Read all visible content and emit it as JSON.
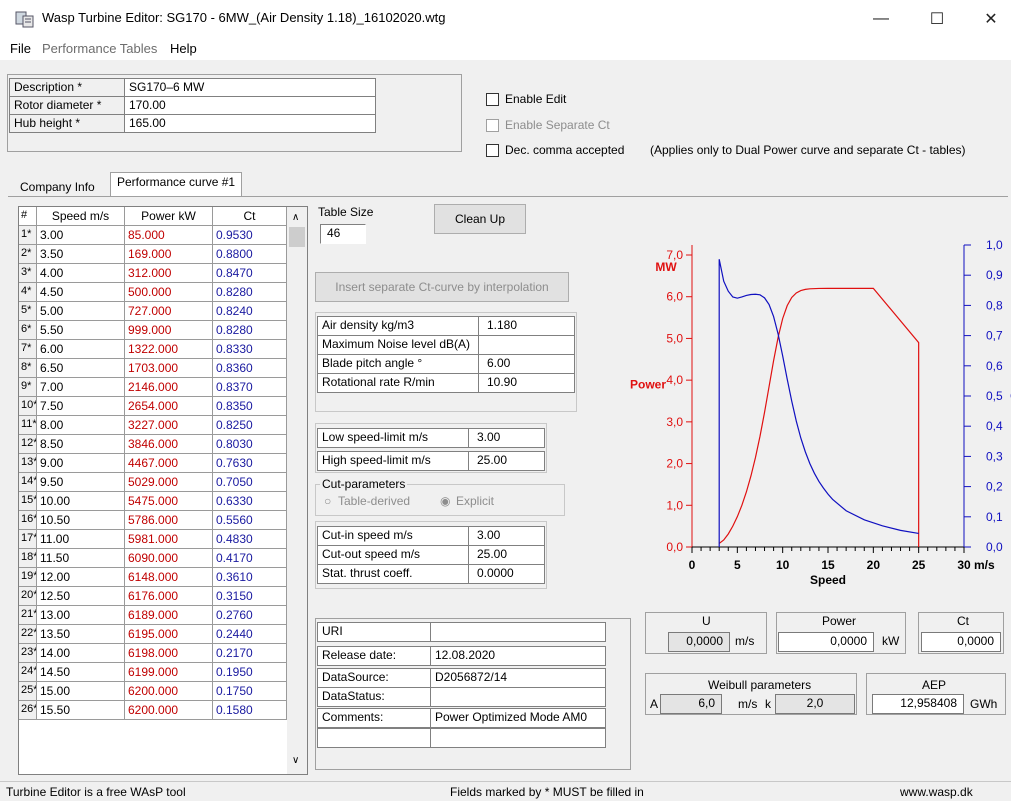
{
  "window": {
    "title": "Wasp Turbine Editor: SG170 - 6MW_(Air Density 1.18)_16102020.wtg",
    "minimize": "—",
    "maximize": "☐",
    "close": "✕"
  },
  "menu": {
    "file": "File",
    "performance_tables": "Performance Tables",
    "help": "Help"
  },
  "header_fields": {
    "description_label": "Description *",
    "description_value": "SG170–6 MW",
    "rotor_label": "Rotor diameter *",
    "rotor_value": "170.00",
    "hub_label": "Hub height *",
    "hub_value": "165.00"
  },
  "options": {
    "enable_edit": "Enable Edit",
    "enable_separate_ct": "Enable Separate Ct",
    "dec_comma": "Dec. comma accepted",
    "dec_comma_note": "(Applies only to Dual Power curve and separate Ct - tables)"
  },
  "tabs": {
    "company_info": "Company Info",
    "performance_curve": "Performance curve #1"
  },
  "grid": {
    "headers": {
      "idx": "#",
      "speed": "Speed m/s",
      "power": "Power kW",
      "ct": "Ct"
    },
    "rows": [
      [
        "1*",
        "3.00",
        "85.000",
        "0.9530"
      ],
      [
        "2*",
        "3.50",
        "169.000",
        "0.8800"
      ],
      [
        "3*",
        "4.00",
        "312.000",
        "0.8470"
      ],
      [
        "4*",
        "4.50",
        "500.000",
        "0.8280"
      ],
      [
        "5*",
        "5.00",
        "727.000",
        "0.8240"
      ],
      [
        "6*",
        "5.50",
        "999.000",
        "0.8280"
      ],
      [
        "7*",
        "6.00",
        "1322.000",
        "0.8330"
      ],
      [
        "8*",
        "6.50",
        "1703.000",
        "0.8360"
      ],
      [
        "9*",
        "7.00",
        "2146.000",
        "0.8370"
      ],
      [
        "10*",
        "7.50",
        "2654.000",
        "0.8350"
      ],
      [
        "11*",
        "8.00",
        "3227.000",
        "0.8250"
      ],
      [
        "12*",
        "8.50",
        "3846.000",
        "0.8030"
      ],
      [
        "13*",
        "9.00",
        "4467.000",
        "0.7630"
      ],
      [
        "14*",
        "9.50",
        "5029.000",
        "0.7050"
      ],
      [
        "15*",
        "10.00",
        "5475.000",
        "0.6330"
      ],
      [
        "16*",
        "10.50",
        "5786.000",
        "0.5560"
      ],
      [
        "17*",
        "11.00",
        "5981.000",
        "0.4830"
      ],
      [
        "18*",
        "11.50",
        "6090.000",
        "0.4170"
      ],
      [
        "19*",
        "12.00",
        "6148.000",
        "0.3610"
      ],
      [
        "20*",
        "12.50",
        "6176.000",
        "0.3150"
      ],
      [
        "21*",
        "13.00",
        "6189.000",
        "0.2760"
      ],
      [
        "22*",
        "13.50",
        "6195.000",
        "0.2440"
      ],
      [
        "23*",
        "14.00",
        "6198.000",
        "0.2170"
      ],
      [
        "24*",
        "14.50",
        "6199.000",
        "0.1950"
      ],
      [
        "25*",
        "15.00",
        "6200.000",
        "0.1750"
      ],
      [
        "26*",
        "15.50",
        "6200.000",
        "0.1580"
      ]
    ]
  },
  "table_size": {
    "label": "Table Size",
    "value": "46"
  },
  "buttons": {
    "clean_up": "Clean Up",
    "insert_ct": "Insert separate Ct-curve by interpolation"
  },
  "params": {
    "air_density_label": "Air density kg/m3",
    "air_density_value": "1.180",
    "noise_label": "Maximum Noise level dB(A)",
    "noise_value": "",
    "pitch_label": "Blade pitch angle °",
    "pitch_value": "6.00",
    "rot_label": "Rotational rate R/min",
    "rot_value": "10.90"
  },
  "limits": {
    "low_label": "Low speed-limit m/s",
    "low_value": "3.00",
    "high_label": "High speed-limit m/s",
    "high_value": "25.00"
  },
  "cut_params": {
    "title": "Cut-parameters",
    "table_derived": "Table-derived",
    "explicit": "Explicit"
  },
  "cut_values": {
    "cutin_label": "Cut-in speed m/s",
    "cutin_value": "3.00",
    "cutout_label": "Cut-out speed m/s",
    "cutout_value": "25.00",
    "thrust_label": "Stat. thrust coeff.",
    "thrust_value": "0.0000"
  },
  "meta": {
    "uri_label": "URI",
    "uri_value": "",
    "release_label": "Release date:",
    "release_value": "12.08.2020",
    "source_label": "DataSource:",
    "source_value": "D2056872/14",
    "status_label": "DataStatus:",
    "status_value": "",
    "comments_label": "Comments:",
    "comments_value": "Power Optimized Mode AM0"
  },
  "readouts": {
    "u_title": "U",
    "u_value": "0,0000",
    "u_unit": "m/s",
    "power_title": "Power",
    "power_value": "0,0000",
    "power_unit": "kW",
    "ct_title": "Ct",
    "ct_value": "0,0000",
    "weibull_title": "Weibull parameters",
    "weibull_a_label": "A",
    "weibull_a_value": "6,0",
    "weibull_unit": "m/s",
    "weibull_k_label": "k",
    "weibull_k_value": "2,0",
    "aep_title": "AEP",
    "aep_value": "12,958408",
    "aep_unit": "GWh"
  },
  "status": {
    "left": "Turbine Editor is a free WAsP tool",
    "middle": "Fields marked by * MUST be filled in",
    "right": "www.wasp.dk"
  },
  "colors": {
    "power": "#e01010",
    "ct": "#1010c0"
  },
  "chart_data": {
    "type": "line",
    "xlabel": "Speed",
    "x_unit": "m/s",
    "left_axis_label": "Power",
    "left_axis_unit": "MW",
    "right_axis_label": "C",
    "xlim": [
      0,
      30
    ],
    "ylim_left": [
      0,
      7
    ],
    "ylim_right": [
      0,
      1.0
    ],
    "x_ticks": [
      "0",
      "5",
      "10",
      "15",
      "20",
      "25",
      "30 m/s"
    ],
    "left_ticks": [
      "0,0",
      "1,0",
      "2,0",
      "3,0",
      "4,0",
      "5,0",
      "6,0",
      "7,0"
    ],
    "right_ticks": [
      "0,0",
      "0,1",
      "0,2",
      "0,3",
      "0,4",
      "0,5",
      "0,6",
      "0,7",
      "0,8",
      "0,9",
      "1,0"
    ],
    "series": [
      {
        "name": "Power",
        "x": [
          3,
          3.5,
          4,
          4.5,
          5,
          5.5,
          6,
          6.5,
          7,
          7.5,
          8,
          8.5,
          9,
          9.5,
          10,
          10.5,
          11,
          11.5,
          12,
          12.5,
          13,
          14,
          15,
          20,
          25,
          25
        ],
        "y": [
          0.085,
          0.169,
          0.312,
          0.5,
          0.727,
          0.999,
          1.322,
          1.703,
          2.146,
          2.654,
          3.227,
          3.846,
          4.467,
          5.029,
          5.475,
          5.786,
          5.981,
          6.09,
          6.148,
          6.176,
          6.189,
          6.198,
          6.2,
          6.2,
          4.9,
          0
        ]
      },
      {
        "name": "Ct",
        "x": [
          3,
          3,
          3.5,
          4,
          4.5,
          5,
          5.5,
          6,
          6.5,
          7,
          7.5,
          8,
          8.5,
          9,
          9.5,
          10,
          10.5,
          11,
          11.5,
          12,
          12.5,
          13,
          13.5,
          14,
          14.5,
          15,
          15.5,
          17,
          19,
          21,
          23,
          25
        ],
        "y": [
          0,
          0.953,
          0.88,
          0.847,
          0.828,
          0.824,
          0.828,
          0.833,
          0.836,
          0.837,
          0.835,
          0.825,
          0.803,
          0.763,
          0.705,
          0.633,
          0.556,
          0.483,
          0.417,
          0.361,
          0.315,
          0.276,
          0.244,
          0.217,
          0.195,
          0.175,
          0.158,
          0.12,
          0.09,
          0.07,
          0.055,
          0.045
        ]
      }
    ]
  }
}
